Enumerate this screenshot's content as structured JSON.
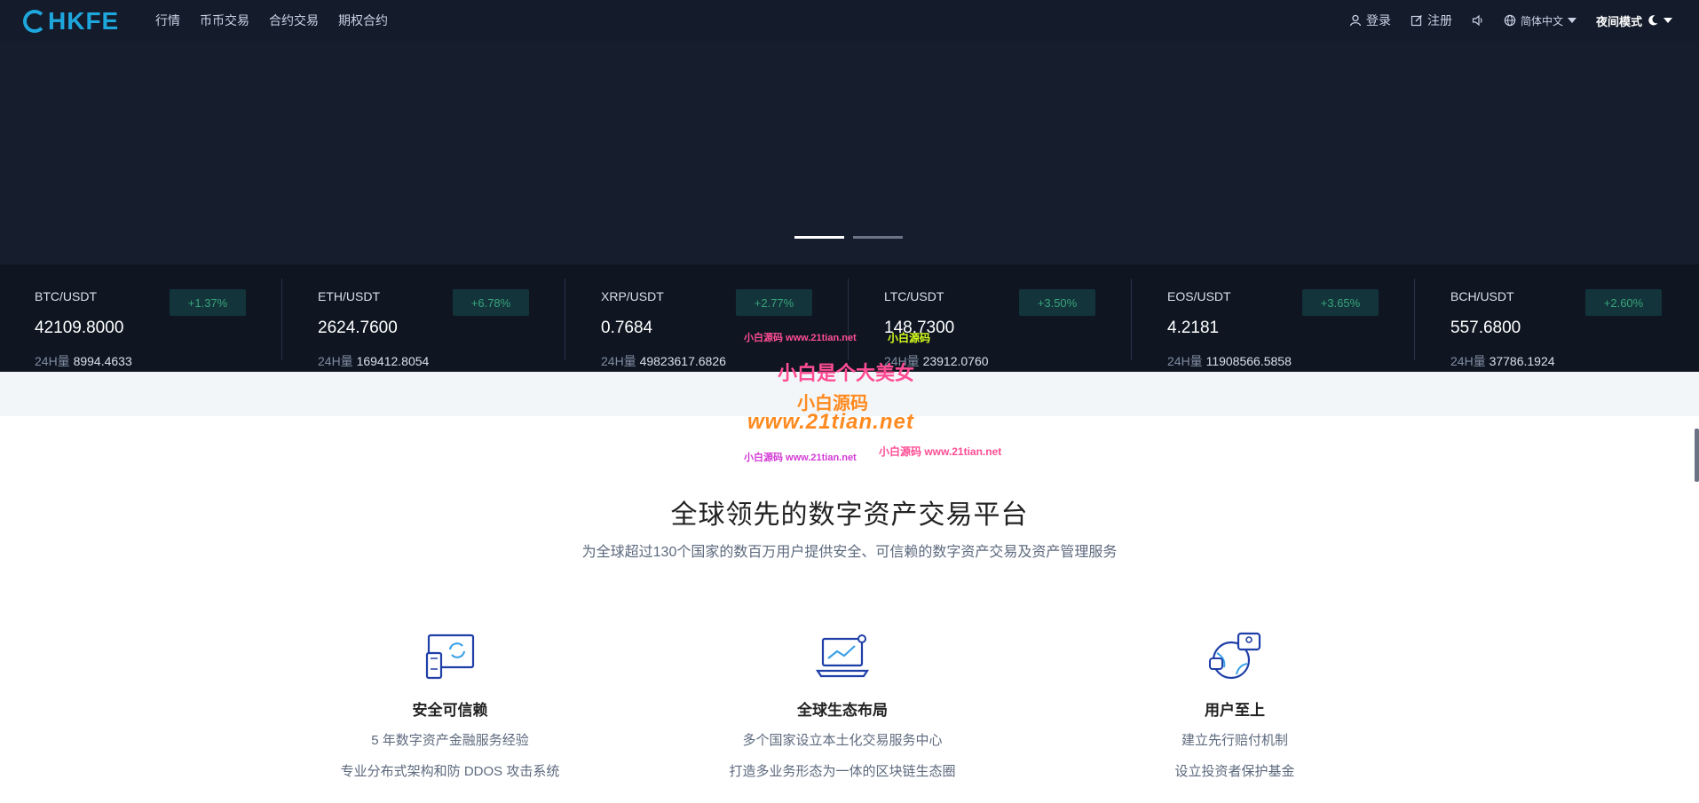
{
  "brand": {
    "logo_text": "HKFE",
    "accent": "#1ea7dd"
  },
  "nav": {
    "left": [
      "行情",
      "币币交易",
      "合约交易",
      "期权合约"
    ],
    "right": {
      "login": "登录",
      "register": "注册",
      "language": "简体中文",
      "night_mode": "夜间模式"
    }
  },
  "ticker": [
    {
      "pair": "BTC/USDT",
      "change": "+1.37%",
      "price": "42109.8000",
      "vol_label": "24H量",
      "vol": "8994.4633"
    },
    {
      "pair": "ETH/USDT",
      "change": "+6.78%",
      "price": "2624.7600",
      "vol_label": "24H量",
      "vol": "169412.8054"
    },
    {
      "pair": "XRP/USDT",
      "change": "+2.77%",
      "price": "0.7684",
      "vol_label": "24H量",
      "vol": "49823617.6826"
    },
    {
      "pair": "LTC/USDT",
      "change": "+3.50%",
      "price": "148.7300",
      "vol_label": "24H量",
      "vol": "23912.0760"
    },
    {
      "pair": "EOS/USDT",
      "change": "+3.65%",
      "price": "4.2181",
      "vol_label": "24H量",
      "vol": "11908566.5858"
    },
    {
      "pair": "BCH/USDT",
      "change": "+2.60%",
      "price": "557.6800",
      "vol_label": "24H量",
      "vol": "37786.1924"
    }
  ],
  "watermark": {
    "line1": "小白是个大美女",
    "line2": "小白源码",
    "line3": "www.21tian.net",
    "small1": "小白源码 www.21tian.net",
    "small2": "小白源码",
    "small3": "小白源码 www.21tian.net",
    "small4": "小白源码 www.21tian.net"
  },
  "hero": {
    "title": "全球领先的数字资产交易平台",
    "subtitle": "为全球超过130个国家的数百万用户提供安全、可信赖的数字资产交易及资产管理服务"
  },
  "features": [
    {
      "title": "安全可信赖",
      "line1": "5 年数字资产金融服务经验",
      "line2": "专业分布式架构和防 DDOS 攻击系统",
      "icon": "device-sync-icon"
    },
    {
      "title": "全球生态布局",
      "line1": "多个国家设立本土化交易服务中心",
      "line2": "打造多业务形态为一体的区块链生态圈",
      "icon": "laptop-chart-icon"
    },
    {
      "title": "用户至上",
      "line1": "建立先行赔付机制",
      "line2": "设立投资者保护基金",
      "icon": "globe-chat-icon"
    }
  ],
  "colors": {
    "nav_bg": "#141b2b",
    "banner_bg": "#161e2e",
    "ticker_bg": "#0f1622",
    "badge_bg": "#12343a",
    "badge_text": "#3aa47c"
  }
}
